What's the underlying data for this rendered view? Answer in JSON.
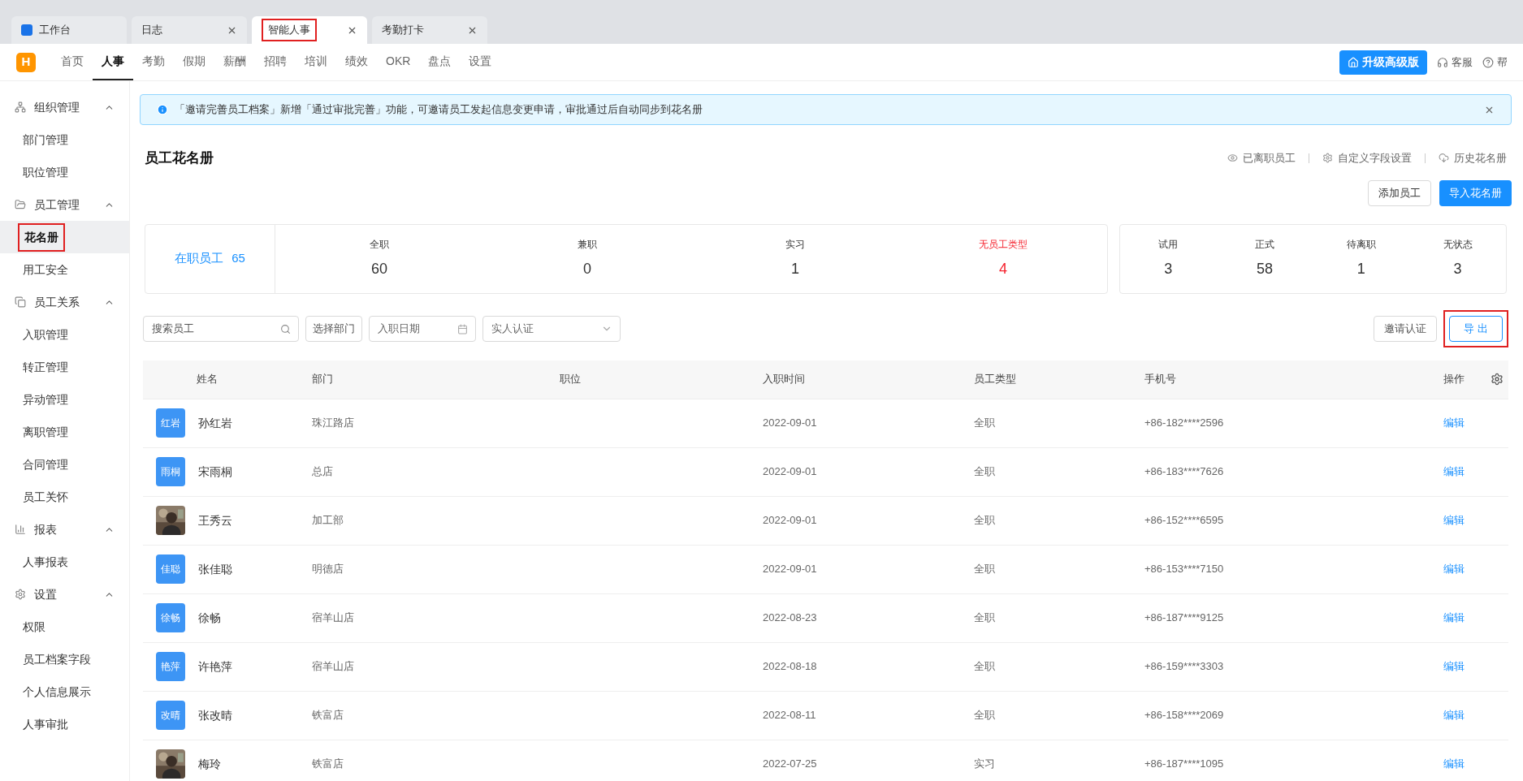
{
  "browser_tabs": [
    {
      "label": "工作台",
      "selected": false,
      "closable": false,
      "annotated": false
    },
    {
      "label": "日志",
      "selected": false,
      "closable": true,
      "annotated": false
    },
    {
      "label": "智能人事",
      "selected": true,
      "closable": true,
      "annotated": true
    },
    {
      "label": "考勤打卡",
      "selected": false,
      "closable": true,
      "annotated": false
    }
  ],
  "nav": {
    "logo": "H",
    "items": [
      {
        "label": "首页",
        "selected": false
      },
      {
        "label": "人事",
        "selected": true
      },
      {
        "label": "考勤",
        "selected": false
      },
      {
        "label": "假期",
        "selected": false
      },
      {
        "label": "薪酬",
        "selected": false
      },
      {
        "label": "招聘",
        "selected": false
      },
      {
        "label": "培训",
        "selected": false
      },
      {
        "label": "绩效",
        "selected": false
      },
      {
        "label": "OKR",
        "selected": false
      },
      {
        "label": "盘点",
        "selected": false
      },
      {
        "label": "设置",
        "selected": false
      }
    ],
    "upgrade": "升级高级版",
    "service": "客服",
    "help": "帮"
  },
  "sidebar": [
    {
      "label": "组织管理",
      "expanded": true,
      "children": [
        {
          "label": "部门管理",
          "selected": false,
          "annotated": false
        },
        {
          "label": "职位管理",
          "selected": false,
          "annotated": false
        }
      ]
    },
    {
      "label": "员工管理",
      "expanded": true,
      "children": [
        {
          "label": "花名册",
          "selected": true,
          "annotated": true
        },
        {
          "label": "用工安全",
          "selected": false,
          "annotated": false
        }
      ]
    },
    {
      "label": "员工关系",
      "expanded": true,
      "children": [
        {
          "label": "入职管理",
          "selected": false,
          "annotated": false
        },
        {
          "label": "转正管理",
          "selected": false,
          "annotated": false
        },
        {
          "label": "异动管理",
          "selected": false,
          "annotated": false
        },
        {
          "label": "离职管理",
          "selected": false,
          "annotated": false
        },
        {
          "label": "合同管理",
          "selected": false,
          "annotated": false
        },
        {
          "label": "员工关怀",
          "selected": false,
          "annotated": false
        }
      ]
    },
    {
      "label": "报表",
      "expanded": true,
      "children": [
        {
          "label": "人事报表",
          "selected": false,
          "annotated": false
        }
      ]
    },
    {
      "label": "设置",
      "expanded": true,
      "children": [
        {
          "label": "权限",
          "selected": false,
          "annotated": false
        },
        {
          "label": "员工档案字段",
          "selected": false,
          "annotated": false
        },
        {
          "label": "个人信息展示",
          "selected": false,
          "annotated": false
        },
        {
          "label": "人事审批",
          "selected": false,
          "annotated": false
        }
      ]
    }
  ],
  "notice": "「邀请完善员工档案」新增「通过审批完善」功能，可邀请员工发起信息变更申请，审批通过后自动同步到花名册",
  "page_title": "员工花名册",
  "header_links": [
    {
      "label": "已离职员工"
    },
    {
      "label": "自定义字段设置"
    },
    {
      "label": "历史花名册"
    }
  ],
  "header_buttons": [
    {
      "label": "添加员工",
      "kind": "default"
    },
    {
      "label": "导入花名册",
      "kind": "primary"
    }
  ],
  "stats": {
    "active_label": "在职员工",
    "active_count": "65",
    "types": [
      {
        "label": "全职",
        "value": "60",
        "warn": false
      },
      {
        "label": "兼职",
        "value": "0",
        "warn": false
      },
      {
        "label": "实习",
        "value": "1",
        "warn": false
      },
      {
        "label": "无员工类型",
        "value": "4",
        "warn": true
      }
    ],
    "statuses": [
      {
        "label": "试用",
        "value": "3"
      },
      {
        "label": "正式",
        "value": "58"
      },
      {
        "label": "待离职",
        "value": "1"
      },
      {
        "label": "无状态",
        "value": "3"
      }
    ]
  },
  "filters": {
    "search": {
      "placeholder": "搜索员工"
    },
    "department": "选择部门",
    "date": {
      "placeholder": "入职日期"
    },
    "verify": {
      "placeholder": "实人认证"
    }
  },
  "actions": [
    {
      "label": "邀请认证",
      "kind": "default",
      "annotated": false
    },
    {
      "label": "导 出",
      "kind": "outline",
      "annotated": true
    }
  ],
  "table": {
    "columns": [
      "姓名",
      "部门",
      "职位",
      "入职时间",
      "员工类型",
      "手机号",
      "操作"
    ],
    "rows": [
      {
        "avatar": {
          "kind": "text",
          "text": "红岩"
        },
        "name": "孙红岩",
        "dept": "珠江路店",
        "date": "2022-09-01",
        "type": "全职",
        "phone": "+86-182****2596",
        "action": "编辑"
      },
      {
        "avatar": {
          "kind": "text",
          "text": "雨桐"
        },
        "name": "宋雨桐",
        "dept": "总店",
        "date": "2022-09-01",
        "type": "全职",
        "phone": "+86-183****7626",
        "action": "编辑"
      },
      {
        "name": "王秀云",
        "dept": "加工部",
        "date": "2022-09-01",
        "type": "全职",
        "phone": "+86-152****6595",
        "action": "编辑"
      },
      {
        "avatar": {
          "kind": "text",
          "text": "佳聪"
        },
        "name": "张佳聪",
        "dept": "明德店",
        "date": "2022-09-01",
        "type": "全职",
        "phone": "+86-153****7150",
        "action": "编辑"
      },
      {
        "avatar": {
          "kind": "text",
          "text": "徐畅"
        },
        "name": "徐畅",
        "dept": "宿羊山店",
        "date": "2022-08-23",
        "type": "全职",
        "phone": "+86-187****9125",
        "action": "编辑"
      },
      {
        "avatar": {
          "kind": "text",
          "text": "艳萍"
        },
        "name": "许艳萍",
        "dept": "宿羊山店",
        "date": "2022-08-18",
        "type": "全职",
        "phone": "+86-159****3303",
        "action": "编辑"
      },
      {
        "avatar": {
          "kind": "text",
          "text": "改晴"
        },
        "name": "张改晴",
        "dept": "铁富店",
        "date": "2022-08-11",
        "type": "全职",
        "phone": "+86-158****2069",
        "action": "编辑"
      },
      {
        "name": "梅玲",
        "dept": "铁富店",
        "date": "2022-07-25",
        "type": "实习",
        "phone": "+86-187****1095",
        "action": "编辑"
      }
    ]
  }
}
